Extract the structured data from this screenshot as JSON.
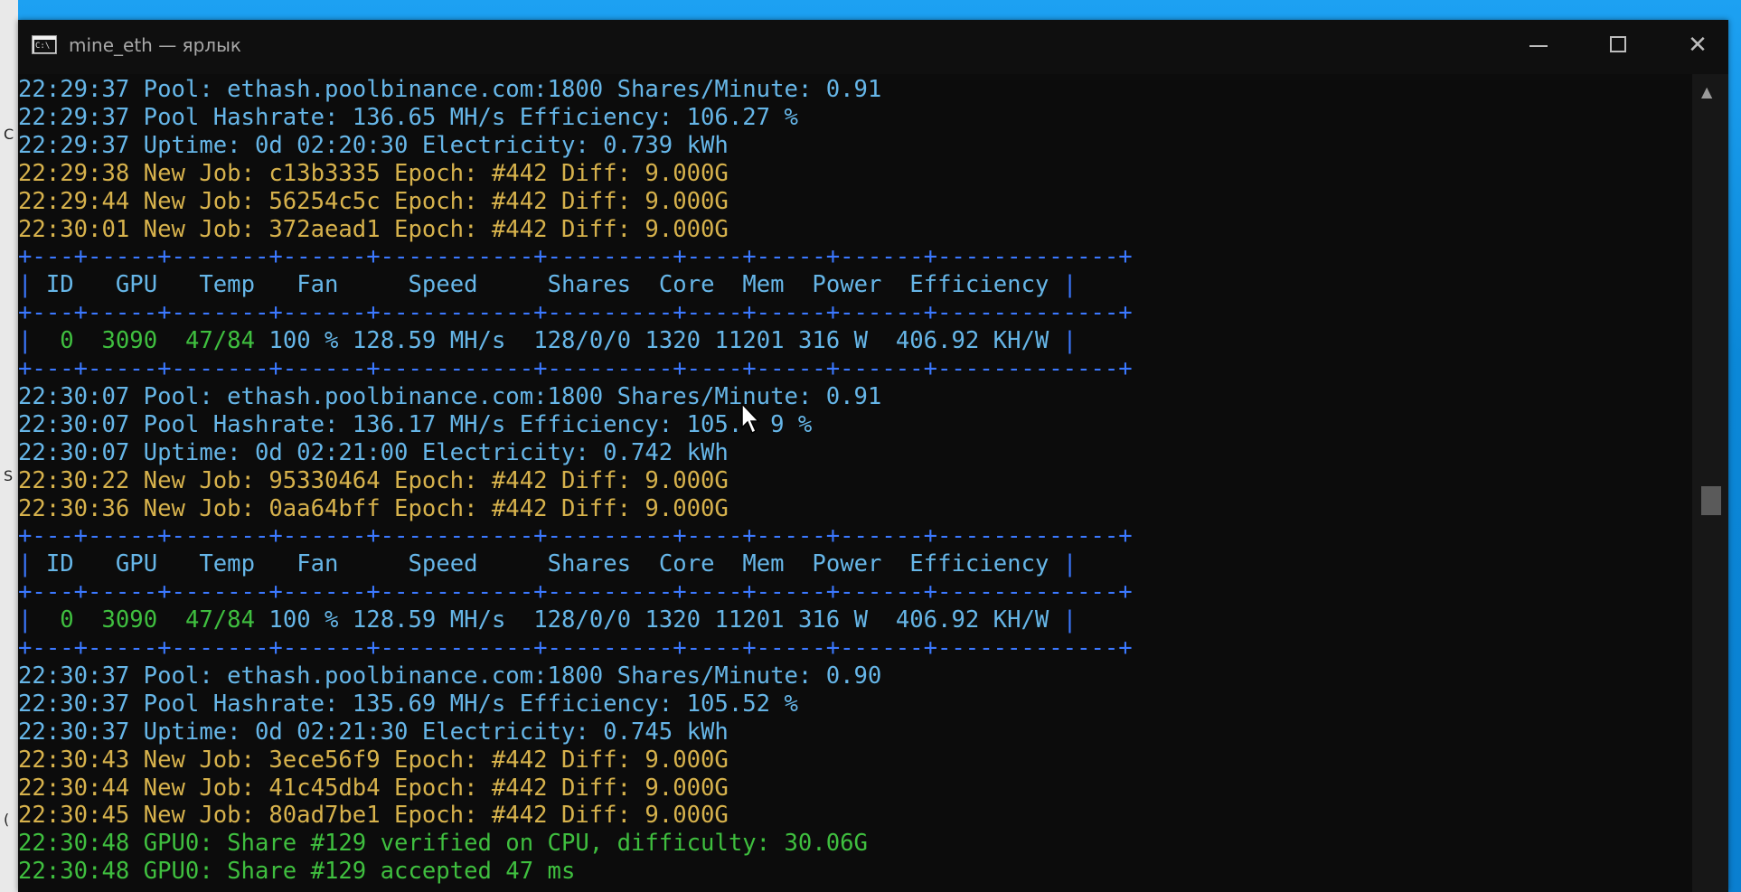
{
  "window": {
    "title": "mine_eth — ярлык",
    "icon_label": "C:\\",
    "minimize_icon": "minimize-icon",
    "maximize_icon": "maximize-icon",
    "close_icon": "close-icon",
    "close_glyph": "✕"
  },
  "left_edge": [
    "C",
    "S",
    "("
  ],
  "colors": {
    "pool_info": "#66b6e8",
    "new_job": "#d7b24c",
    "share": "#3fbf3f",
    "table_border": "#3b78ff",
    "table_text": "#cccccc"
  },
  "table": {
    "separator": "+---+-----+-------+------+-----------+---------+----+-----+------+-------------+",
    "header": [
      "ID",
      "GPU",
      "Temp",
      "Fan",
      "Speed",
      "Shares",
      "Core",
      "Mem",
      "Power",
      "Efficiency"
    ],
    "row": {
      "id": "0",
      "gpu": "3090",
      "temp": "47/84",
      "rest": "100 % 128.59 MH/s  128/0/0 1320 11201 316 W  406.92 KH/W"
    }
  },
  "log": [
    {
      "kind": "pool",
      "text": "22:29:37 Pool: ethash.poolbinance.com:1800 Shares/Minute: 0.91"
    },
    {
      "kind": "pool",
      "text": "22:29:37 Pool Hashrate: 136.65 MH/s Efficiency: 106.27 %"
    },
    {
      "kind": "pool",
      "text": "22:29:37 Uptime: 0d 02:20:30 Electricity: 0.739 kWh"
    },
    {
      "kind": "job",
      "text": "22:29:38 New Job: c13b3335 Epoch: #442 Diff: 9.000G"
    },
    {
      "kind": "job",
      "text": "22:29:44 New Job: 56254c5c Epoch: #442 Diff: 9.000G"
    },
    {
      "kind": "job",
      "text": "22:30:01 New Job: 372aead1 Epoch: #442 Diff: 9.000G"
    },
    {
      "kind": "table"
    },
    {
      "kind": "pool",
      "text": "22:30:07 Pool: ethash.poolbinance.com:1800 Shares/Minute: 0.91"
    },
    {
      "kind": "pool",
      "text": "22:30:07 Pool Hashrate: 136.17 MH/s Efficiency: 105.  9 %"
    },
    {
      "kind": "pool",
      "text": "22:30:07 Uptime: 0d 02:21:00 Electricity: 0.742 kWh"
    },
    {
      "kind": "job",
      "text": "22:30:22 New Job: 95330464 Epoch: #442 Diff: 9.000G"
    },
    {
      "kind": "job",
      "text": "22:30:36 New Job: 0aa64bff Epoch: #442 Diff: 9.000G"
    },
    {
      "kind": "table"
    },
    {
      "kind": "pool",
      "text": "22:30:37 Pool: ethash.poolbinance.com:1800 Shares/Minute: 0.90"
    },
    {
      "kind": "pool",
      "text": "22:30:37 Pool Hashrate: 135.69 MH/s Efficiency: 105.52 %"
    },
    {
      "kind": "pool",
      "text": "22:30:37 Uptime: 0d 02:21:30 Electricity: 0.745 kWh"
    },
    {
      "kind": "job",
      "text": "22:30:43 New Job: 3ece56f9 Epoch: #442 Diff: 9.000G"
    },
    {
      "kind": "job",
      "text": "22:30:44 New Job: 41c45db4 Epoch: #442 Diff: 9.000G"
    },
    {
      "kind": "job",
      "text": "22:30:45 New Job: 80ad7be1 Epoch: #442 Diff: 9.000G"
    },
    {
      "kind": "share",
      "text": "22:30:48 GPU0: Share #129 verified on CPU, difficulty: 30.06G"
    },
    {
      "kind": "share",
      "text": "22:30:48 GPU0: Share #129 accepted 47 ms"
    }
  ]
}
